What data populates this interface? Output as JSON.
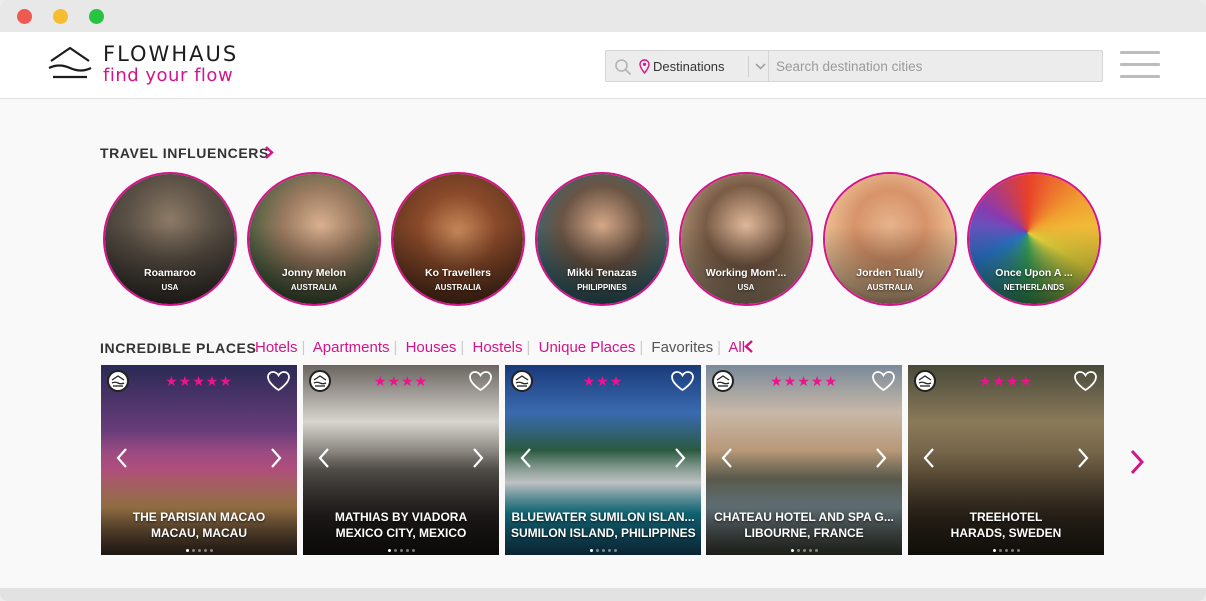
{
  "brand": {
    "name": "FLOWHAUS",
    "tagline": "find your flow"
  },
  "search": {
    "destinations_label": "Destinations",
    "placeholder": "Search destination cities"
  },
  "influencers_section": {
    "title": "TRAVEL INFLUENCERS",
    "items": [
      {
        "name": "Roamaroo",
        "country": "USA"
      },
      {
        "name": "Jonny Melon",
        "country": "AUSTRALIA"
      },
      {
        "name": "Ko Travellers",
        "country": "AUSTRALIA"
      },
      {
        "name": "Mikki Tenazas",
        "country": "PHILIPPINES"
      },
      {
        "name": "Working Mom'...",
        "country": "USA"
      },
      {
        "name": "Jorden Tually",
        "country": "AUSTRALIA"
      },
      {
        "name": "Once Upon A ...",
        "country": "NETHERLANDS"
      }
    ]
  },
  "places_section": {
    "title": "INCREDIBLE PLACES",
    "filters": [
      "Hotels",
      "Apartments",
      "Houses",
      "Hostels",
      "Unique Places",
      "Favorites",
      "All"
    ],
    "cards": [
      {
        "title": "THE PARISIAN MACAO",
        "location": "MACAU, MACAU",
        "stars": "★★★★★"
      },
      {
        "title": "MATHIAS BY VIADORA",
        "location": "MEXICO CITY, MEXICO",
        "stars": "★★★★"
      },
      {
        "title": "BLUEWATER SUMILON ISLAN...",
        "location": "SUMILON ISLAND, PHILIPPINES",
        "stars": "★★★"
      },
      {
        "title": "CHATEAU HOTEL AND SPA G...",
        "location": "LIBOURNE, FRANCE",
        "stars": "★★★★★"
      },
      {
        "title": "TREEHOTEL",
        "location": "HARADS, SWEDEN",
        "stars": "★★★★"
      }
    ]
  },
  "colors": {
    "accent": "#d4148a",
    "star": "#ec1290"
  },
  "icons": [
    "search-icon",
    "location-pin-icon",
    "chevron-down-icon",
    "hamburger-icon",
    "chevron-right-icon",
    "chevron-left-icon",
    "heart-icon",
    "flowhaus-badge-icon"
  ]
}
